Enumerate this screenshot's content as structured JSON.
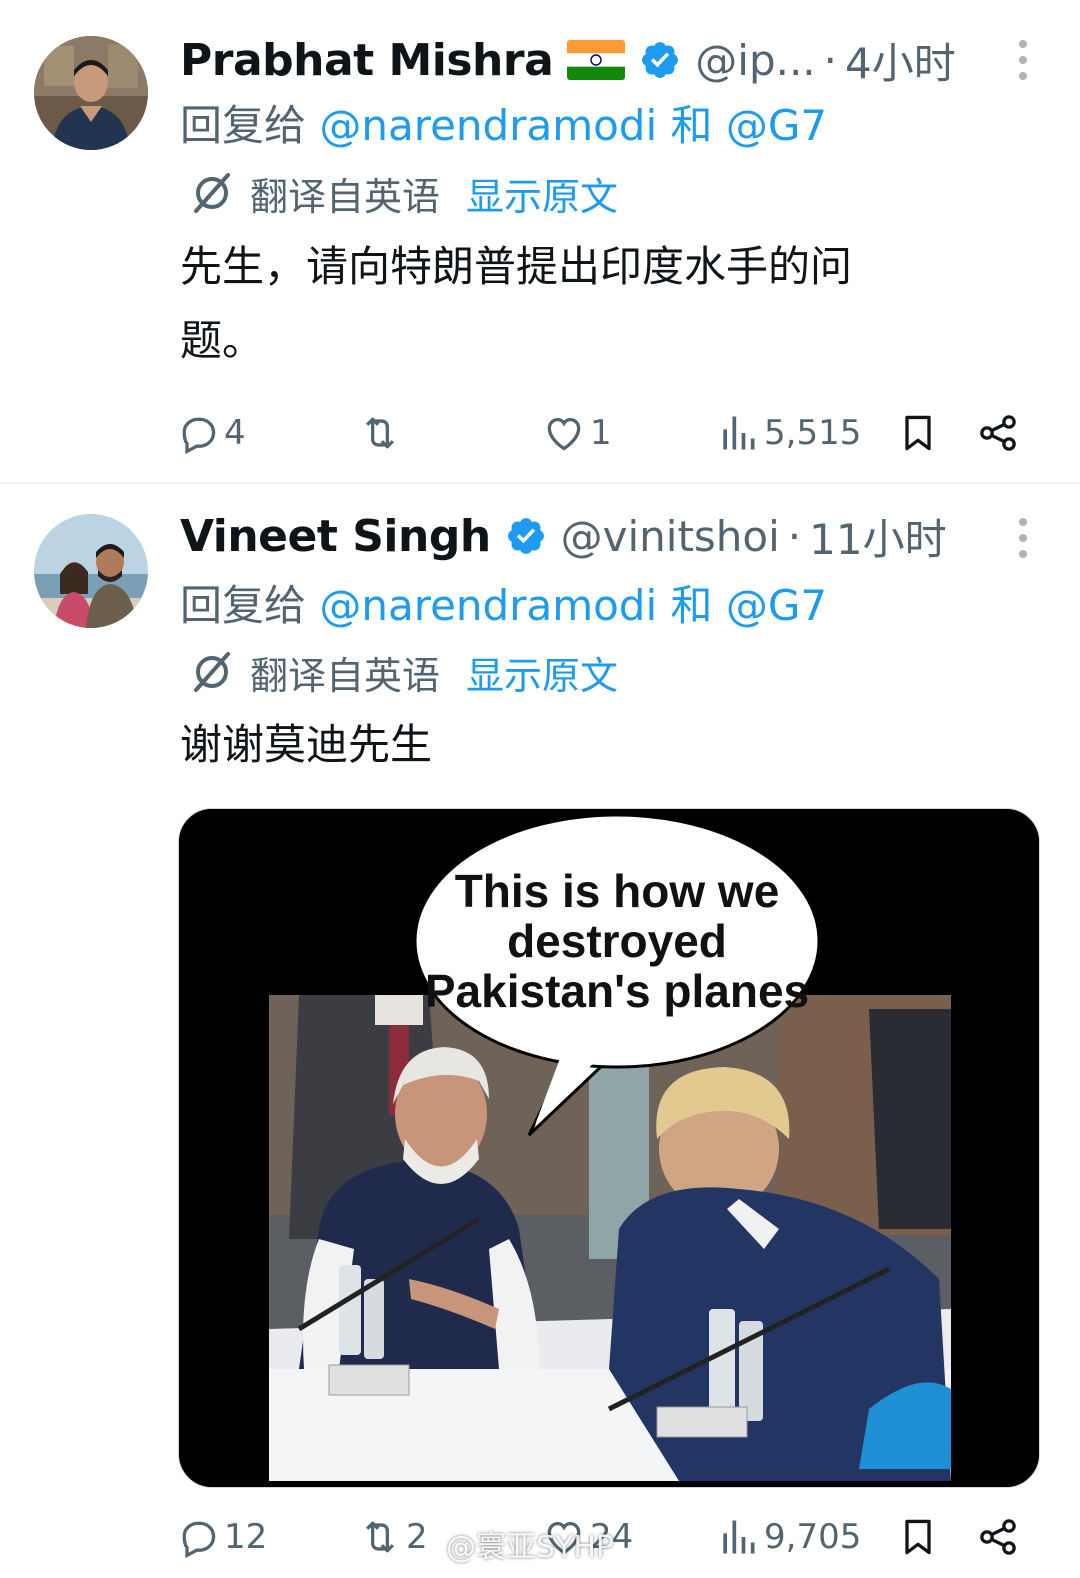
{
  "tweets": [
    {
      "display_name": "Prabhat Mishra",
      "handle": "@ip...",
      "separator": "·",
      "time": "4小时",
      "reply_prefix": "回复给",
      "reply_mention_1": "@narendramodi",
      "reply_and": "和",
      "reply_mention_2": "@G7",
      "translated_label": "翻译自英语",
      "show_original": "显示原文",
      "text_line1": "先生，请向特朗普提出印度水手的问",
      "text_line2": "题。",
      "replies": "4",
      "retweets": "",
      "likes": "1",
      "views": "5,515"
    },
    {
      "display_name": "Vineet Singh",
      "handle": "@vinitshoi",
      "separator": "·",
      "time": "11小时",
      "reply_prefix": "回复给",
      "reply_mention_1": "@narendramodi",
      "reply_and": "和",
      "reply_mention_2": "@G7",
      "translated_label": "翻译自英语",
      "show_original": "显示原文",
      "text_line1": "谢谢莫迪先生",
      "media_caption_line1": "This is how we",
      "media_caption_line2": "destroyed",
      "media_caption_line3": "Pakistan's planes",
      "replies": "12",
      "retweets": "2",
      "likes": "24",
      "views": "9,705"
    }
  ],
  "watermark": "@寰亚SYHP",
  "icons": {
    "reply": "reply-icon",
    "retweet": "retweet-icon",
    "like": "heart-icon",
    "views": "views-chart-icon",
    "bookmark": "bookmark-icon",
    "share": "share-icon",
    "verified": "verified-badge-icon",
    "translate": "translate-icon",
    "more": "more-options-icon"
  },
  "colors": {
    "accent": "#1d9bf0",
    "secondary_text": "#536471",
    "primary_text": "#0f1419"
  }
}
